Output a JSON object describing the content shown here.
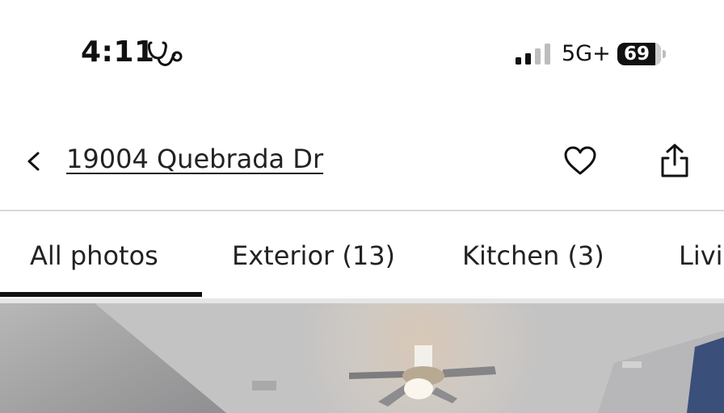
{
  "status_bar": {
    "time": "4:11",
    "health_icon": "stethoscope-icon",
    "signal_icon": "cellular-signal-icon",
    "network": "5G+",
    "battery": "69"
  },
  "header": {
    "back_icon": "chevron-left-icon",
    "address": "19004 Quebrada Dr",
    "favorite_icon": "heart-icon",
    "share_icon": "share-icon"
  },
  "tabs": [
    {
      "label": "All photos",
      "active": true
    },
    {
      "label": "Exterior (13)",
      "active": false
    },
    {
      "label": "Kitchen (3)",
      "active": false
    },
    {
      "label": "Livi",
      "active": false
    }
  ],
  "photo": {
    "subject": "room with ceiling fan"
  },
  "colors": {
    "text": "#1a1a1a",
    "active_tab_underline": "#111111",
    "divider": "#d8d8d8"
  }
}
